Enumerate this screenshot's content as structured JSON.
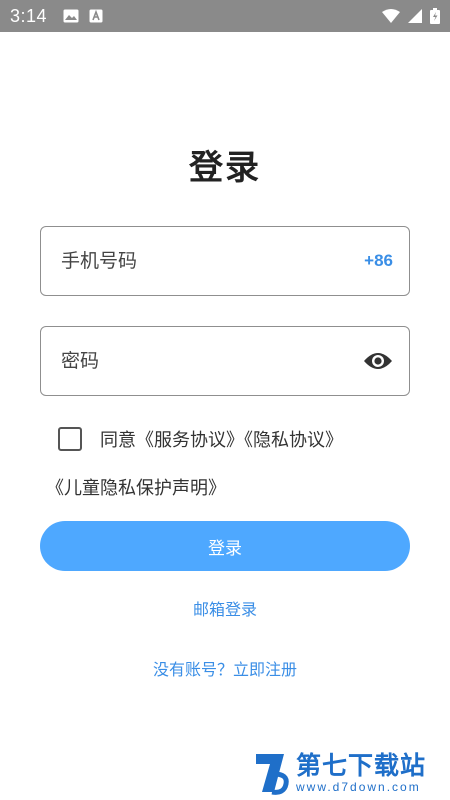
{
  "status_bar": {
    "time": "3:14",
    "icons": [
      "image-icon",
      "a-badge-icon",
      "wifi-icon",
      "signal-icon",
      "battery-icon"
    ]
  },
  "page": {
    "title": "登录"
  },
  "phone_field": {
    "placeholder": "手机号码",
    "value": "",
    "country_code": "+86"
  },
  "password_field": {
    "placeholder": "密码",
    "value": "",
    "toggle_icon": "eye-icon"
  },
  "agreement": {
    "checked": false,
    "prefix": "同意",
    "service_terms": "《服务协议》",
    "privacy_policy": "《隐私协议》",
    "child_privacy": "《儿童隐私保护声明》"
  },
  "actions": {
    "login_label": "登录",
    "email_login_label": "邮箱登录",
    "register_label": "没有账号？立即注册"
  },
  "watermark": {
    "title": "第七下载站",
    "url": "www.d7down.com"
  },
  "colors": {
    "accent": "#4ea8ff",
    "link": "#3a8ee6",
    "status_bar": "#8a8a8a",
    "watermark": "#1f6fc9"
  }
}
